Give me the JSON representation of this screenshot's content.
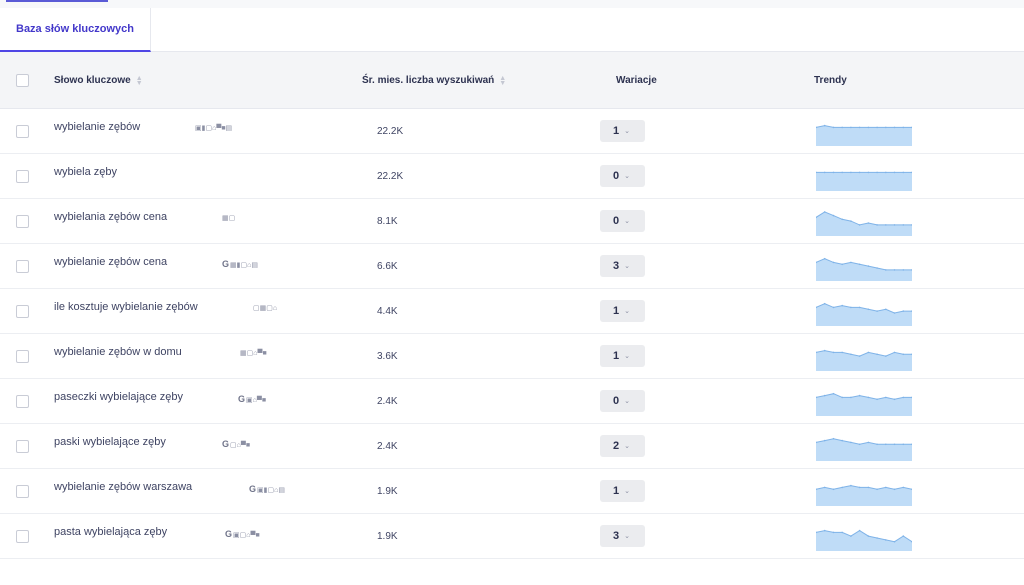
{
  "tab": {
    "label": "Baza słów kluczowych"
  },
  "columns": {
    "keyword": "Słowo kluczowe",
    "volume": "Śr. mies. liczba wyszukiwań",
    "variations": "Wariacje",
    "trends": "Trendy"
  },
  "colors": {
    "accent": "#4f46e5",
    "trend_fill": "#bfdcf7",
    "trend_line": "#7fb3e8"
  },
  "rows": [
    {
      "keyword": "wybielanie zębów",
      "features": [
        "image-icon",
        "video-icon",
        "chat-icon",
        "shop-icon",
        "ad-icon",
        "camera-icon",
        "news-icon"
      ],
      "has_google": false,
      "volume": "22.2K",
      "variations": "1",
      "trend": [
        10,
        11,
        10,
        10,
        10,
        10,
        10,
        10,
        10,
        10,
        10,
        10
      ]
    },
    {
      "keyword": "wybiela zęby",
      "features": [],
      "has_google": false,
      "volume": "22.2K",
      "variations": "0",
      "trend": [
        10,
        10,
        10,
        10,
        10,
        10,
        10,
        10,
        10,
        10,
        10,
        10
      ]
    },
    {
      "keyword": "wybielania zębów cena",
      "features": [
        "review-icon",
        "chat-icon"
      ],
      "has_google": false,
      "volume": "8.1K",
      "variations": "0",
      "trend": [
        10,
        13,
        11,
        9,
        8,
        6,
        7,
        6,
        6,
        6,
        6,
        6
      ]
    },
    {
      "keyword": "wybielanie zębów cena",
      "features": [
        "review-icon",
        "video-icon",
        "chat-icon",
        "shop-icon",
        "news-icon"
      ],
      "has_google": true,
      "volume": "6.6K",
      "variations": "3",
      "trend": [
        10,
        12,
        10,
        9,
        10,
        9,
        8,
        7,
        6,
        6,
        6,
        6
      ]
    },
    {
      "keyword": "ile kosztuje wybielanie zębów",
      "features": [
        "chat-icon",
        "review-icon",
        "chat-icon",
        "shop-icon"
      ],
      "has_google": false,
      "volume": "4.4K",
      "variations": "1",
      "trend": [
        10,
        12,
        10,
        11,
        10,
        10,
        9,
        8,
        9,
        7,
        8,
        8
      ]
    },
    {
      "keyword": "wybielanie zębów w domu",
      "features": [
        "review-icon",
        "chat-icon",
        "shop-icon",
        "ad-icon",
        "camera-icon"
      ],
      "has_google": false,
      "volume": "3.6K",
      "variations": "1",
      "trend": [
        10,
        11,
        10,
        10,
        9,
        8,
        10,
        9,
        8,
        10,
        9,
        9
      ]
    },
    {
      "keyword": "paseczki wybielające zęby",
      "features": [
        "image-icon",
        "shop-icon",
        "ad-icon",
        "camera-icon"
      ],
      "has_google": true,
      "volume": "2.4K",
      "variations": "0",
      "trend": [
        10,
        11,
        12,
        10,
        10,
        11,
        10,
        9,
        10,
        9,
        10,
        10
      ]
    },
    {
      "keyword": "paski wybielające zęby",
      "features": [
        "chat-icon",
        "shop-icon",
        "ad-icon",
        "camera-icon"
      ],
      "has_google": true,
      "volume": "2.4K",
      "variations": "2",
      "trend": [
        10,
        11,
        12,
        11,
        10,
        9,
        10,
        9,
        9,
        9,
        9,
        9
      ]
    },
    {
      "keyword": "wybielanie zębów warszawa",
      "features": [
        "image-icon",
        "video-icon",
        "chat-icon",
        "shop-icon",
        "news-icon"
      ],
      "has_google": true,
      "volume": "1.9K",
      "variations": "1",
      "trend": [
        9,
        10,
        9,
        10,
        11,
        10,
        10,
        9,
        10,
        9,
        10,
        9
      ]
    },
    {
      "keyword": "pasta wybielająca zęby",
      "features": [
        "image-icon",
        "chat-icon",
        "shop-icon",
        "ad-icon",
        "camera-icon"
      ],
      "has_google": true,
      "volume": "1.9K",
      "variations": "3",
      "trend": [
        10,
        11,
        10,
        10,
        8,
        11,
        8,
        7,
        6,
        5,
        8,
        5
      ]
    }
  ]
}
